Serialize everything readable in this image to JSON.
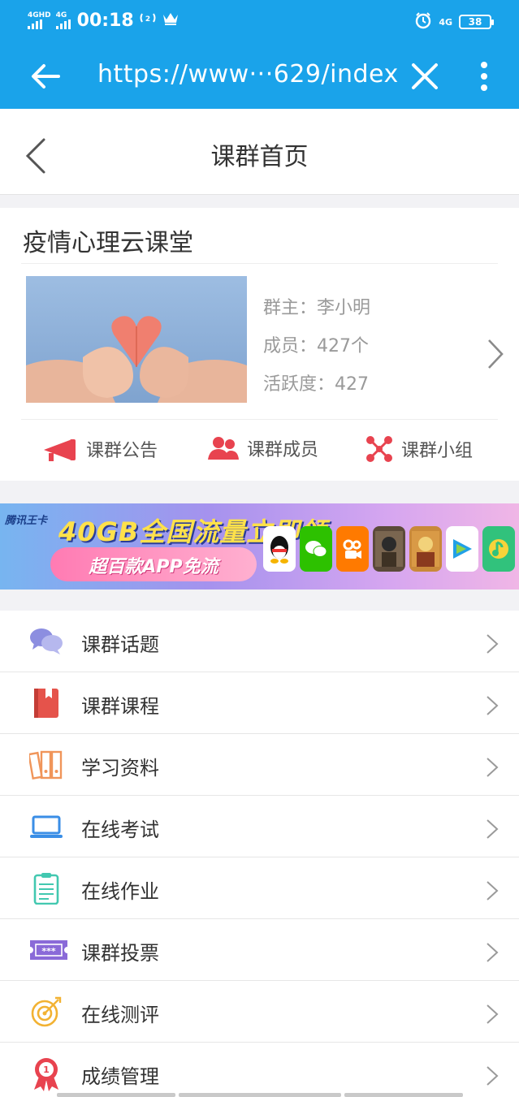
{
  "status_bar": {
    "signal1_label": "4GHD",
    "signal2_label": "4G",
    "time": "00:18",
    "net_label": "4G",
    "battery": "38",
    "icons": [
      "wifi-calling-icon",
      "crown-icon",
      "alarm-icon"
    ]
  },
  "browser": {
    "url": "https://www···629/index",
    "icons": [
      "back-arrow-icon",
      "close-icon",
      "more-vert-icon"
    ]
  },
  "header": {
    "title": "课群首页"
  },
  "group": {
    "name": "疫情心理云课堂",
    "owner_label": "群主：",
    "owner_value": "李小明",
    "members_label": "成员：",
    "members_value": "427个",
    "activity_label": "活跃度：",
    "activity_value": "427",
    "actions": [
      {
        "label": "课群公告",
        "icon": "megaphone-icon"
      },
      {
        "label": "课群成员",
        "icon": "members-icon"
      },
      {
        "label": "课群小组",
        "icon": "group-nodes-icon"
      }
    ]
  },
  "banner": {
    "tag": "腾讯王卡",
    "title": "40GB全国流量立即领",
    "subtitle": "超百款APP免流",
    "app_icons": [
      "qq-icon",
      "wechat-icon",
      "kuaishou-icon",
      "pubg-icon",
      "hok-icon",
      "tencent-video-icon",
      "qq-music-icon"
    ]
  },
  "menu": [
    {
      "label": "课群话题",
      "icon": "chat-bubbles-icon",
      "color": "#8c8ee0"
    },
    {
      "label": "课群课程",
      "icon": "book-icon",
      "color": "#e5534b"
    },
    {
      "label": "学习资料",
      "icon": "binders-icon",
      "color": "#f0955a"
    },
    {
      "label": "在线考试",
      "icon": "laptop-icon",
      "color": "#3a8ee6"
    },
    {
      "label": "在线作业",
      "icon": "clipboard-icon",
      "color": "#42c8b0"
    },
    {
      "label": "课群投票",
      "icon": "ticket-icon",
      "color": "#8a6ad8"
    },
    {
      "label": "在线测评",
      "icon": "target-icon",
      "color": "#f2b233"
    },
    {
      "label": "成绩管理",
      "icon": "award-ribbon-icon",
      "color": "#e8434f"
    }
  ],
  "colors": {
    "accent": "#1aa3ea",
    "action_red": "#e8434f"
  }
}
